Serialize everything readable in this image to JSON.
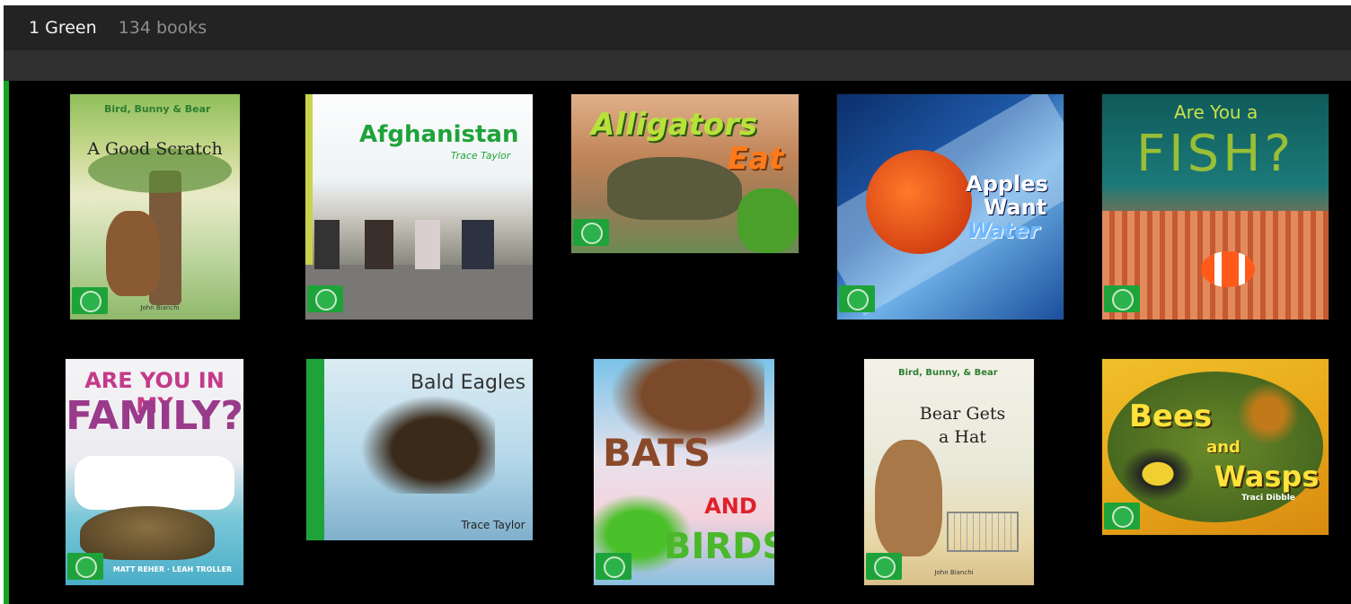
{
  "header": {
    "shelf_name": "1 Green",
    "book_count": "134 books"
  },
  "books": [
    {
      "series": "Bird, Bunny & Bear",
      "title": "A Good Scratch",
      "author": "John Bianchi"
    },
    {
      "title": "Afghanistan",
      "author": "Trace Taylor"
    },
    {
      "title_line1": "Alligators",
      "title_line2": "Eat"
    },
    {
      "title_line1": "Apples",
      "title_line2": "Want",
      "title_line3": "Water"
    },
    {
      "title_top": "Are You a",
      "title_main": "FISH?"
    },
    {
      "title_line1": "ARE YOU IN MY",
      "title_line2": "FAMILY?",
      "authors": "MATT REHER · LEAH TROLLER"
    },
    {
      "title": "Bald Eagles",
      "author": "Trace Taylor"
    },
    {
      "title_line1": "BATS",
      "title_line2": "AND",
      "title_line3": "BIRDS"
    },
    {
      "series": "Bird, Bunny, & Bear",
      "title_line1": "Bear Gets",
      "title_line2": "a Hat",
      "author": "John Bianchi"
    },
    {
      "title_line1": "Bees",
      "title_line2": "and",
      "title_line3": "Wasps",
      "author": "Traci Dibble"
    }
  ],
  "colors": {
    "header_bg": "#232323",
    "toolbar_bg": "#303030",
    "accent_green": "#17a325"
  }
}
